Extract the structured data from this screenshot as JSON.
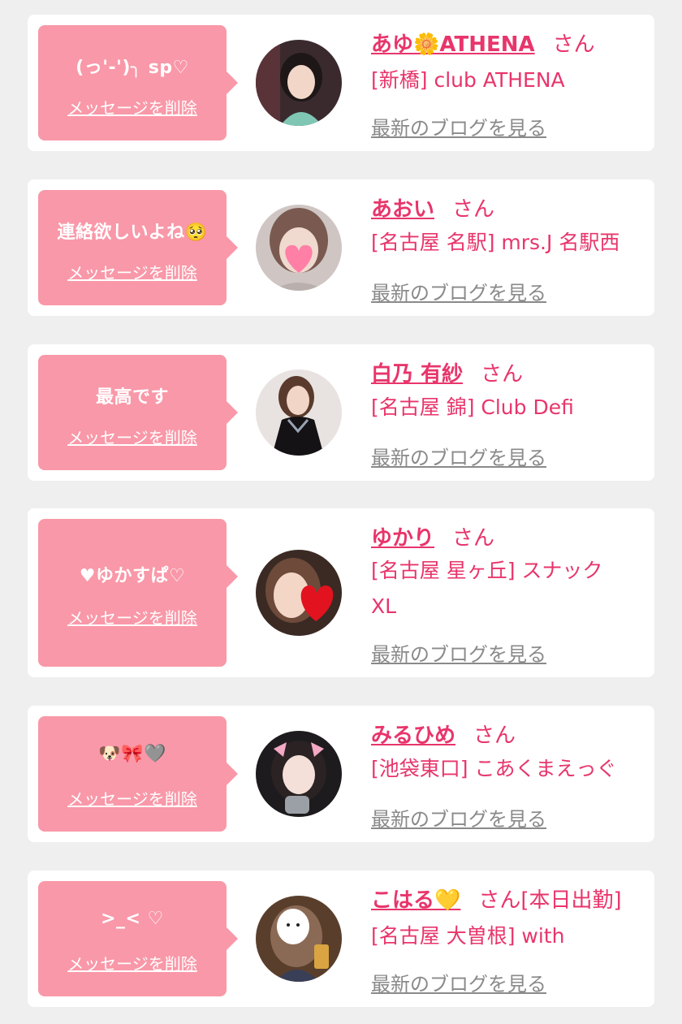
{
  "colors": {
    "background": "#efefef",
    "card": "#ffffff",
    "bubble": "#f998a8",
    "accent": "#e8356b",
    "link_gray": "#8a8a8a"
  },
  "items": [
    {
      "message": "(っ'-')╮ sp♡",
      "delete_label": "メッセージを削除",
      "name": "あゆ🌼ATHENA",
      "honorific": "さん",
      "extra": "",
      "shop": "[新橋] club ATHENA",
      "blog_label": "最新のブログを見る",
      "avatar_icon": "profile-photo"
    },
    {
      "message": "連絡欲しいよね🥺",
      "delete_label": "メッセージを削除",
      "name": "あおい",
      "honorific": "さん",
      "extra": "",
      "shop": "[名古屋 名駅] mrs.J 名駅西",
      "blog_label": "最新のブログを見る",
      "avatar_icon": "profile-photo-heart-sticker"
    },
    {
      "message": "最高です",
      "delete_label": "メッセージを削除",
      "name": "白乃 有紗",
      "honorific": "さん",
      "extra": "",
      "shop": "[名古屋 錦] Club Defi",
      "blog_label": "最新のブログを見る",
      "avatar_icon": "profile-photo"
    },
    {
      "message": "♥ゆかすぱ♡",
      "delete_label": "メッセージを削除",
      "name": "ゆかり",
      "honorific": "さん",
      "extra": "",
      "shop": "[名古屋 星ヶ丘] スナック XL",
      "blog_label": "最新のブログを見る",
      "avatar_icon": "profile-photo-heart-sticker"
    },
    {
      "message": "🐶🎀🩶",
      "delete_label": "メッセージを削除",
      "name": "みるひめ",
      "honorific": "さん",
      "extra": "",
      "shop": "[池袋東口] こあくまえっぐ",
      "blog_label": "最新のブログを見る",
      "avatar_icon": "profile-photo"
    },
    {
      "message": ">_< ♡",
      "delete_label": "メッセージを削除",
      "name": "こはる💛",
      "honorific": "さん",
      "extra": "[本日出勤]",
      "shop": "[名古屋 大曽根] with",
      "blog_label": "最新のブログを見る",
      "avatar_icon": "profile-photo-face-sticker"
    }
  ]
}
